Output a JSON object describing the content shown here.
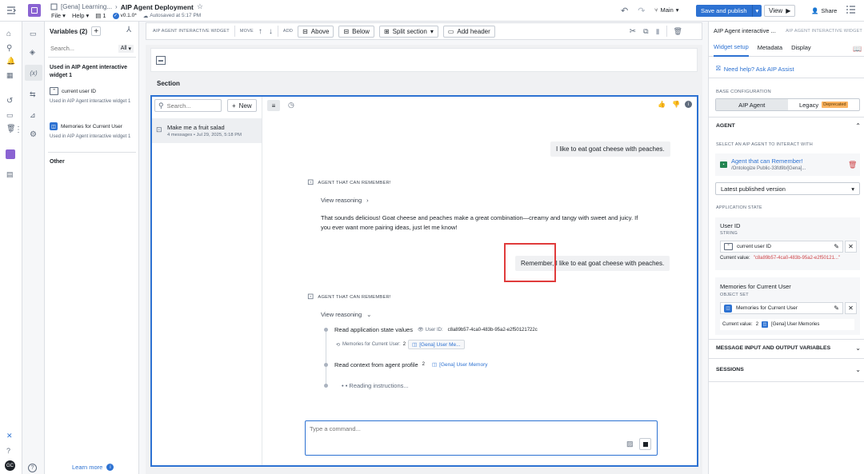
{
  "app": {
    "breadcrumb_parent": "[Gena] Learning...",
    "title": "AIP Agent Deployment",
    "menu_file": "File",
    "menu_help": "Help",
    "page_count": "1",
    "version": "v0.1.0*",
    "autosave": "Autosaved at 5:17 PM",
    "branch": "Main",
    "save_publish": "Save and publish",
    "view": "View",
    "share": "Share"
  },
  "variables": {
    "title": "Variables (2)",
    "search_placeholder": "Search...",
    "filter": "All",
    "section_used": "Used in AIP Agent interactive widget 1",
    "items": [
      {
        "name": "current user ID",
        "used_in": "Used in  AIP Agent interactive widget 1"
      },
      {
        "name": "Memories for Current User",
        "used_in": "Used in  AIP Agent interactive widget 1"
      }
    ],
    "section_other": "Other",
    "learn_more": "Learn more"
  },
  "toolbar": {
    "widget_label": "AIP AGENT INTERACTIVE WIDGET",
    "move_label": "MOVE",
    "add_label": "ADD",
    "above": "Above",
    "below": "Below",
    "split": "Split section",
    "add_header": "Add header"
  },
  "section": {
    "title": "Section"
  },
  "widget": {
    "search_placeholder": "Search...",
    "new_button": "New",
    "conversation_title": "Make me a fruit salad",
    "conversation_meta": "4 messages • Jul 29, 2025, 5:18 PM",
    "messages": {
      "user1": "I like to eat goat cheese with peaches.",
      "agent_name": "AGENT THAT CAN REMEMBER!",
      "view_reasoning": "View reasoning",
      "agent_reply": "That sounds delicious! Goat cheese and peaches make a great combination—creamy and tangy with sweet and juicy. If you ever want more pairing ideas, just let me know!",
      "user2": "Remember, I like to eat goat cheese with peaches.",
      "agent_name2": "AGENT THAT CAN REMEMBER!",
      "view_reasoning2": "View reasoning",
      "step1": "Read application state values",
      "step1_userid_label": "User ID:",
      "step1_userid": "c8a89b57-4ca0-483b-95a2-e2f50121722c",
      "step1_mem_label": "Memories for Current User:",
      "step1_mem_count": "2",
      "step1_mem_chip": "[Gena] User Me...",
      "step2": "Read context from agent profile",
      "step2_count": "2",
      "step2_chip": "[Gena] User Memory",
      "step3": "• • Reading instructions..."
    },
    "input_placeholder": "Type a command..."
  },
  "right": {
    "title": "AIP Agent interactive ...",
    "subtitle": "AIP AGENT INTERACTIVE WIDGET",
    "tabs": [
      "Widget setup",
      "Metadata",
      "Display"
    ],
    "help": "Need help? Ask AIP Assist",
    "base_config": "BASE CONFIGURATION",
    "seg_aip": "AIP Agent",
    "seg_legacy": "Legacy",
    "deprecated": "Deprecated",
    "agent_header": "AGENT",
    "select_label": "SELECT AN AIP AGENT TO INTERACT WITH",
    "agent_name": "Agent that can Remember!",
    "agent_path": "/Ontologize Public-33fd9b/[Gena]...",
    "version_select": "Latest published version",
    "app_state": "APPLICATION STATE",
    "user_id_label": "User ID",
    "user_id_type": "STRING",
    "user_id_var": "current user ID",
    "current_value_label": "Current value:",
    "user_id_value": "\"c8a89b57-4ca0-483b-95a2-e2f50121...\"",
    "mem_label": "Memories for Current User",
    "mem_type": "OBJECT SET",
    "mem_var": "Memories for Current User",
    "mem_count": "2",
    "mem_value": "[Gena] User Memories",
    "msg_vars": "MESSAGE INPUT AND OUTPUT VARIABLES",
    "sessions": "SESSIONS"
  },
  "colors": {
    "accent": "#2d72d2",
    "highlight": "#e03c3c",
    "delete": "#cd4246"
  }
}
